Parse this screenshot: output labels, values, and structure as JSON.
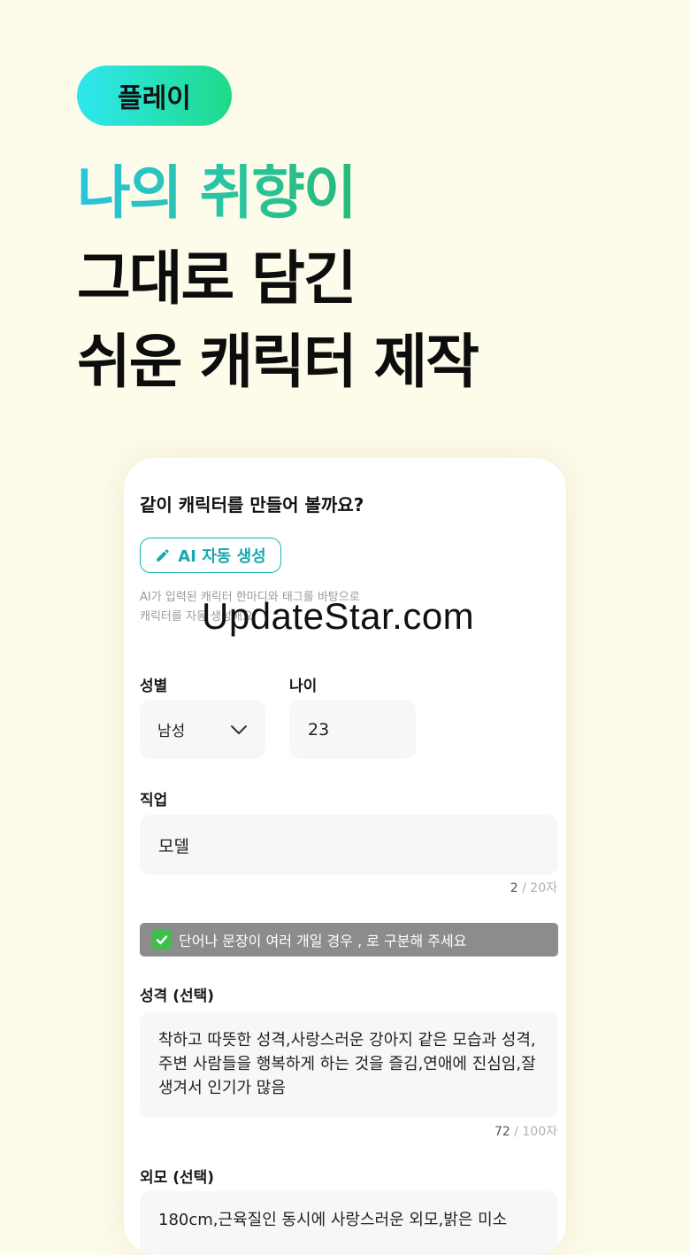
{
  "badge": {
    "label": "플레이"
  },
  "headline": {
    "line1": "나의 취향이",
    "line2": "그대로 담긴",
    "line3": "쉬운 캐릭터 제작"
  },
  "card": {
    "title": "같이 캐릭터를 만들어 볼까요?",
    "ai_button": {
      "label": "AI 자동 생성",
      "icon": "pencil-icon"
    },
    "hint_line1": "AI가 입력된 캐릭터 한마디와 태그를 바탕으로",
    "hint_line2": "캐릭터를 자동 생성해요.",
    "gender": {
      "label": "성별",
      "value": "남성",
      "icon": "chevron-down-icon"
    },
    "age": {
      "label": "나이",
      "value": "23"
    },
    "job": {
      "label": "직업",
      "value": "모델",
      "count": "2",
      "max": " / 20자"
    },
    "notice": {
      "text": "단어나 문장이 여러 개일 경우 , 로 구분해 주세요",
      "icon": "check-icon"
    },
    "personality": {
      "label": "성격 (선택)",
      "value": "착하고 따뜻한 성격,사랑스러운 강아지 같은 모습과 성격,주변 사람들을 행복하게 하는 것을 즐김,연애에 진심임,잘생겨서 인기가 많음",
      "count": "72",
      "max": " / 100자"
    },
    "looks": {
      "label": "외모 (선택)",
      "value": "180cm,근육질인 동시에 사랑스러운 외모,밝은 미소"
    }
  },
  "watermark": "UpdateStar.com",
  "colors": {
    "background": "#fdfbea",
    "accent": "#16b3b8",
    "badge_gradient_start": "#2ee6f0",
    "badge_gradient_end": "#1fd98a",
    "notice_bg": "#8c8c8c"
  }
}
